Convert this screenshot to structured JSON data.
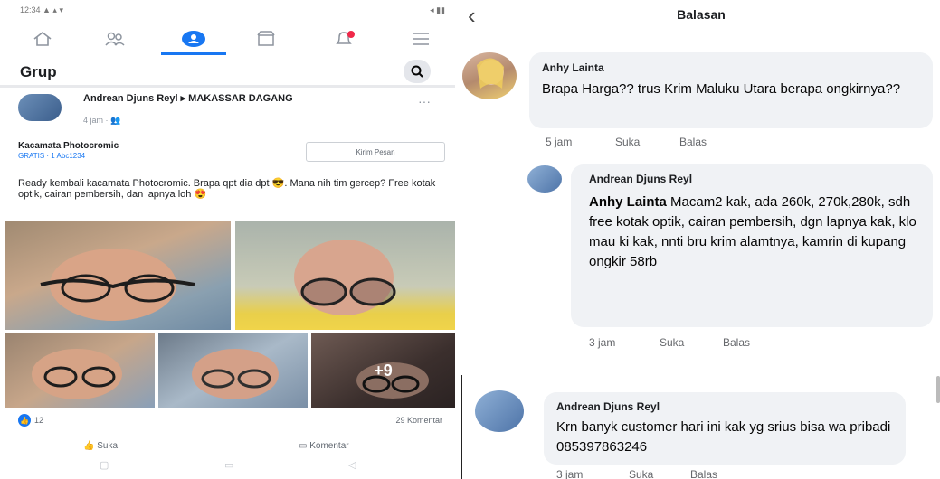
{
  "left": {
    "status_left": "12:34 ▲ ▴ ▾",
    "status_right": "◂ ▮▮",
    "nav": [
      "home-icon",
      "friends-icon",
      "groups-icon",
      "marketplace-icon",
      "notifications-icon",
      "menu-icon"
    ],
    "section_title": "Grup",
    "post": {
      "author": "Andrean Djuns Reyl ▸ MAKASSAR DAGANG",
      "time": "4 jam · 👥",
      "item_title": "Kacamata Photocromic",
      "item_price": "GRATIS · 1 Abc1234",
      "send_button": "Kirim Pesan",
      "text": "Ready kembali kacamata Photocromic. Brapa qpt dia dpt 😎. Mana nih tim gercep? Free kotak optik, cairan pembersih, dan lapnya loh 😍",
      "photo_more": "+9",
      "reaction_count": "12",
      "comment_count": "29 Komentar",
      "like_label": "Suka",
      "comment_label": "Komentar"
    }
  },
  "right": {
    "title": "Balasan",
    "comments": [
      {
        "name": "Anhy Lainta",
        "text": "Brapa Harga?? trus Krim Maluku Utara berapa ongkirnya??",
        "time": "5 jam",
        "like": "Suka",
        "reply": "Balas"
      },
      {
        "name": "Andrean Djuns Reyl",
        "mention": "Anhy Lainta",
        "text": " Macam2 kak, ada 260k, 270k,280k, sdh free kotak optik, cairan pembersih, dgn lapnya kak, klo mau ki kak, nnti bru krim alamtnya, kamrin di kupang ongkir 58rb",
        "time": "3 jam",
        "like": "Suka",
        "reply": "Balas"
      },
      {
        "name": "Andrean Djuns Reyl",
        "text": "Krn banyk customer hari ini kak yg srius bisa wa pribadi 085397863246",
        "time": "3 jam",
        "like": "Suka",
        "reply": "Balas"
      }
    ]
  },
  "colors": {
    "accent": "#1877f2",
    "bubble": "#f0f2f5",
    "meta": "#65676b"
  }
}
